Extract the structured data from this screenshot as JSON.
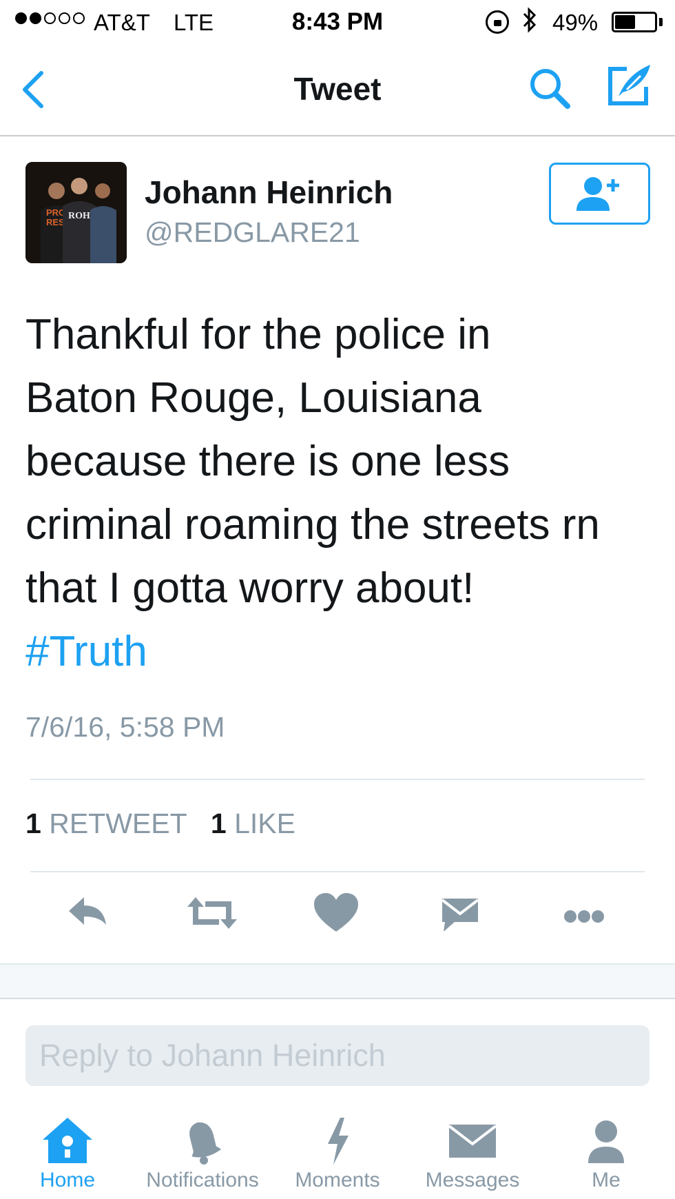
{
  "status_bar": {
    "carrier": "AT&T",
    "network": "LTE",
    "time": "8:43 PM",
    "battery_percent": "49%",
    "signal_bars_filled": 2,
    "signal_bars_total": 5,
    "battery_level": 0.49
  },
  "nav": {
    "title": "Tweet",
    "back_icon": "chevron-left-icon",
    "search_icon": "search-icon",
    "compose_icon": "compose-tweet-icon"
  },
  "tweet": {
    "author_name": "Johann Heinrich",
    "author_handle": "@REDGLARE21",
    "follow_icon": "add-user-icon",
    "text_lines": [
      "Thankful for the police in",
      "Baton Rouge, Louisiana",
      "because there is one less",
      "criminal roaming the streets rn",
      "that I gotta worry about!"
    ],
    "hashtag": "#Truth",
    "timestamp": "7/6/16, 5:58 PM",
    "retweet_count": "1",
    "retweet_label": "RETWEET",
    "like_count": "1",
    "like_label": "LIKE"
  },
  "actions": [
    "reply-icon",
    "retweet-icon",
    "like-icon",
    "direct-message-icon",
    "more-icon"
  ],
  "reply": {
    "placeholder": "Reply to Johann Heinrich"
  },
  "tabbar": {
    "tabs": [
      {
        "label": "Home",
        "icon": "home-icon",
        "active": true
      },
      {
        "label": "Notifications",
        "icon": "bell-icon",
        "active": false
      },
      {
        "label": "Moments",
        "icon": "lightning-icon",
        "active": false
      },
      {
        "label": "Messages",
        "icon": "envelope-icon",
        "active": false
      },
      {
        "label": "Me",
        "icon": "person-icon",
        "active": false
      }
    ]
  },
  "colors": {
    "accent": "#1da1f2",
    "secondary_text": "#8899a6",
    "icon_gray": "#8899a6",
    "primary_text": "#14171a"
  }
}
